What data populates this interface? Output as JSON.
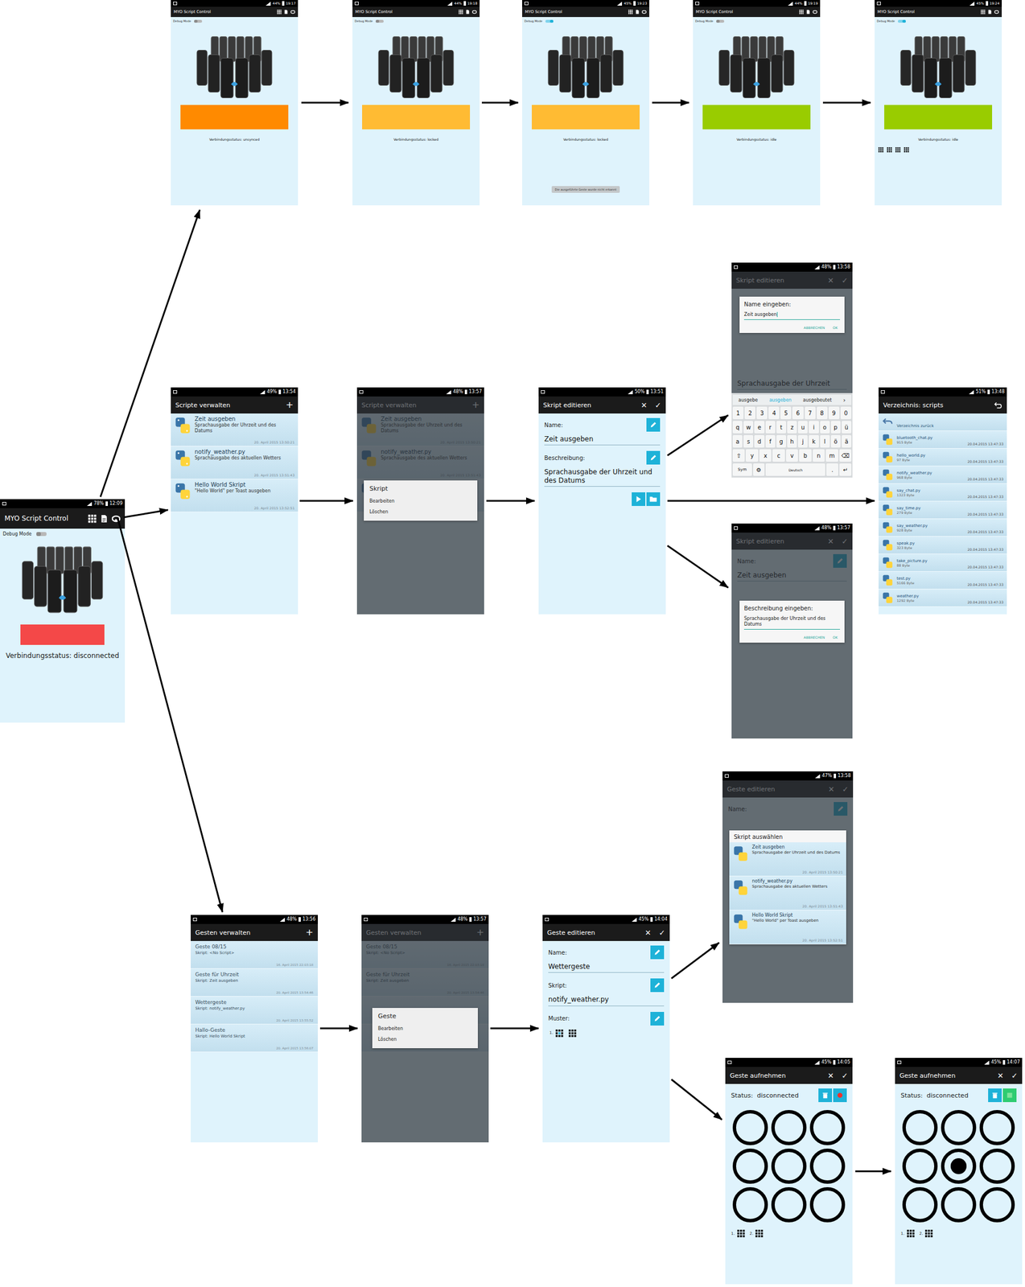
{
  "main": {
    "time": "12:09",
    "battery": "78%",
    "title": "MYO Script Control",
    "debug_label": "Debug Mode",
    "debug_on": false,
    "status": "Verbindungsstatus: disconnected",
    "color": "#f44848"
  },
  "sync_screens": [
    {
      "time": "19:17",
      "battery": "44%",
      "title": "MYO Script Control",
      "debug_label": "Debug Mode",
      "debug_on": false,
      "status": "Verbindungsstatus: unsynced",
      "color": "#ff8a00",
      "toast": "",
      "patterns": 0
    },
    {
      "time": "19:18",
      "battery": "44%",
      "title": "MYO Script Control",
      "debug_label": "Debug Mode",
      "debug_on": false,
      "status": "Verbindungsstatus: locked",
      "color": "#ffbb33",
      "toast": "",
      "patterns": 0
    },
    {
      "time": "19:23",
      "battery": "45%",
      "title": "MYO Script Control",
      "debug_label": "Debug Mode",
      "debug_on": true,
      "status": "Verbindungsstatus: locked",
      "color": "#ffbb33",
      "toast": "Die ausgeführte Geste wurde nicht erkannt",
      "patterns": 0
    },
    {
      "time": "19:19",
      "battery": "44%",
      "title": "MYO Script Control",
      "debug_label": "Debug Mode",
      "debug_on": false,
      "status": "Verbindungsstatus: idle",
      "color": "#99cc00",
      "toast": "",
      "patterns": 0
    },
    {
      "time": "19:24",
      "battery": "45%",
      "title": "MYO Script Control",
      "debug_label": "Debug Mode",
      "debug_on": true,
      "status": "Verbindungsstatus: idle",
      "color": "#99cc00",
      "toast": "",
      "patterns": 4
    }
  ],
  "script_list": {
    "time": "13:54",
    "battery": "49%",
    "title": "Scripte verwalten",
    "add": "+",
    "items": [
      {
        "name": "Zeit ausgeben",
        "desc": "Sprachausgabe der Uhrzeit und des Datums",
        "date": "20. April 2015 13:50:21"
      },
      {
        "name": "notify_weather.py",
        "desc": "Sprachausgabe des aktuellen Wetters",
        "date": "20. April 2015 13:51:43"
      },
      {
        "name": "Hello World Skript",
        "desc": "\"Hello World\" per Toast ausgeben",
        "date": "20. April 2015 13:52:51"
      }
    ]
  },
  "script_menu": {
    "time": "13:57",
    "battery": "48%",
    "title": "Scripte verwalten",
    "add": "+",
    "items": [
      {
        "name": "Zeit ausgeben",
        "desc": "Sprachausgabe der Uhrzeit und des Datums",
        "date": "20. April 2015 13:50:21"
      },
      {
        "name": "notify_weather.py",
        "desc": "Sprachausgabe des aktuellen Wetters",
        "date": "20. April 2015 13:51:43"
      }
    ],
    "menu": {
      "title": "Skript",
      "entries": [
        "Bearbeiten",
        "Löschen"
      ]
    }
  },
  "script_edit": {
    "time": "13:51",
    "battery": "50%",
    "title": "Skript editieren",
    "cancel": "✕",
    "confirm": "✓",
    "fields": [
      {
        "label": "Name:",
        "value": "Zeit ausgeben"
      },
      {
        "label": "Beschreibung:",
        "value": "Sprachausgabe der Uhrzeit und des Datums"
      }
    ]
  },
  "name_dialog": {
    "time": "13:58",
    "battery": "48%",
    "title": "Skript editieren",
    "cancel": "✕",
    "confirm": "✓",
    "dialog": {
      "title": "Name eingeben:",
      "value": "Zeit ausgeben",
      "buttons": [
        "ABBRECHEN",
        "OK"
      ]
    },
    "behind": "Sprachausgabe der Uhrzeit",
    "suggestions": [
      {
        "text": "ausgebe",
        "selected": false
      },
      {
        "text": "ausgeben",
        "selected": true
      },
      {
        "text": "ausgebeutet",
        "selected": false
      }
    ],
    "suggest_more": "›",
    "keys": [
      [
        "1",
        "2",
        "3",
        "4",
        "5",
        "6",
        "7",
        "8",
        "9",
        "0"
      ],
      [
        "q",
        "w",
        "e",
        "r",
        "t",
        "z",
        "u",
        "i",
        "o",
        "p",
        "ü"
      ],
      [
        "a",
        "s",
        "d",
        "f",
        "g",
        "h",
        "j",
        "k",
        "l",
        "ö",
        "ä"
      ],
      [
        "⇧",
        "y",
        "x",
        "c",
        "v",
        "b",
        "n",
        "m",
        "⌫"
      ],
      [
        "Sym",
        "⚙",
        "Deutsch",
        ".",
        "↵"
      ]
    ]
  },
  "desc_dialog": {
    "time": "13:57",
    "battery": "48%",
    "title": "Skript editieren",
    "cancel": "✕",
    "confirm": "✓",
    "name_label": "Name:",
    "name_value": "Zeit ausgeben",
    "dialog": {
      "title": "Beschreibung eingeben:",
      "value": "Sprachausgabe der Uhrzeit und des Datums",
      "buttons": [
        "ABBRECHEN",
        "OK"
      ]
    }
  },
  "directory": {
    "time": "13:48",
    "battery": "51%",
    "title": "Verzeichnis: scripts",
    "back": "Verzeichnis zurück",
    "files": [
      {
        "name": "bluetooth_chat.py",
        "size": "915 Byte",
        "date": "20.04.2015 13:47:33"
      },
      {
        "name": "hello_world.py",
        "size": "97 Byte",
        "date": "20.04.2015 13:47:33"
      },
      {
        "name": "notify_weather.py",
        "size": "968 Byte",
        "date": "20.04.2015 13:47:33"
      },
      {
        "name": "say_chat.py",
        "size": "1323 Byte",
        "date": "20.04.2015 13:47:33"
      },
      {
        "name": "say_time.py",
        "size": "279 Byte",
        "date": "20.04.2015 13:47:33"
      },
      {
        "name": "say_weather.py",
        "size": "928 Byte",
        "date": "20.04.2015 13:47:33"
      },
      {
        "name": "speak.py",
        "size": "323 Byte",
        "date": "20.04.2015 13:47:33"
      },
      {
        "name": "take_picture.py",
        "size": "88 Byte",
        "date": "20.04.2015 13:47:33"
      },
      {
        "name": "test.py",
        "size": "5166 Byte",
        "date": "20.04.2015 13:47:33"
      },
      {
        "name": "weather.py",
        "size": "1292 Byte",
        "date": "20.04.2015 13:47:33"
      }
    ]
  },
  "gesture_list": {
    "time": "13:56",
    "battery": "48%",
    "title": "Gesten verwalten",
    "add": "+",
    "items": [
      {
        "name": "Geste 08/15",
        "script": "Skript: <No Script>",
        "date": "16. April 2015 22:03:18"
      },
      {
        "name": "Geste für Uhrzeit",
        "script": "Skript: Zeit ausgeben",
        "date": "20. April 2015 13:54:46"
      },
      {
        "name": "Wettergeste",
        "script": "Skript: notify_weather.py",
        "date": "20. April 2015 13:55:52"
      },
      {
        "name": "Hallo-Geste",
        "script": "Skript: Hello World Skript",
        "date": "20. April 2015 13:56:07"
      }
    ]
  },
  "gesture_menu": {
    "time": "13:57",
    "battery": "48%",
    "title": "Gesten verwalten",
    "add": "+",
    "items": [
      {
        "name": "Geste 08/15",
        "script": "Skript: <No Script>",
        "date": "16. April 2015 22:03:18"
      },
      {
        "name": "Geste für Uhrzeit",
        "script": "Skript: Zeit ausgeben",
        "date": "20. April 2015 13:54:46"
      }
    ],
    "menu": {
      "title": "Geste",
      "entries": [
        "Bearbeiten",
        "Löschen"
      ]
    }
  },
  "gesture_edit": {
    "time": "14:04",
    "battery": "45%",
    "title": "Geste editieren",
    "cancel": "✕",
    "confirm": "✓",
    "fields": [
      {
        "label": "Name:",
        "value": "Wettergeste"
      },
      {
        "label": "Skript:",
        "value": "notify_weather.py"
      }
    ],
    "pattern_label": "Muster:",
    "patterns": [
      {
        "label": "1.",
        "dot": 4
      },
      {
        "label": "",
        "dot": -1
      }
    ]
  },
  "script_select": {
    "time": "13:58",
    "battery": "47%",
    "title": "Geste editieren",
    "cancel": "✕",
    "confirm": "✓",
    "name_label": "Name:",
    "dialog_title": "Skript auswählen",
    "items": [
      {
        "name": "Zeit ausgeben",
        "desc": "Sprachausgabe der Uhrzeit und des Datums",
        "date": "20. April 2015 13:50:21"
      },
      {
        "name": "notify_weather.py",
        "desc": "Sprachausgabe des aktuellen Wetters",
        "date": "20. April 2015 13:51:43"
      },
      {
        "name": "Hello World Skript",
        "desc": "\"Hello World\" per Toast ausgeben",
        "date": "20. April 2015 13:52:51"
      }
    ]
  },
  "recordings": [
    {
      "time": "14:05",
      "battery": "45%",
      "title": "Geste aufnehmen",
      "cancel": "✕",
      "confirm": "✓",
      "status": "Status:  disconnected",
      "recording": false,
      "cells": [
        false,
        false,
        false,
        false,
        false,
        false,
        false,
        false,
        false
      ],
      "patterns": [
        {
          "label": "1.",
          "dot": -1
        },
        {
          "label": "2.",
          "dot": -1
        }
      ]
    },
    {
      "time": "14:07",
      "battery": "45%",
      "title": "Geste aufnehmen",
      "cancel": "✕",
      "confirm": "✓",
      "status": "Status:  disconnected",
      "recording": true,
      "cells": [
        false,
        false,
        false,
        false,
        true,
        false,
        false,
        false,
        false
      ],
      "patterns": [
        {
          "label": "1.",
          "dot": -1
        },
        {
          "label": "2.",
          "dot": -1
        }
      ]
    }
  ]
}
